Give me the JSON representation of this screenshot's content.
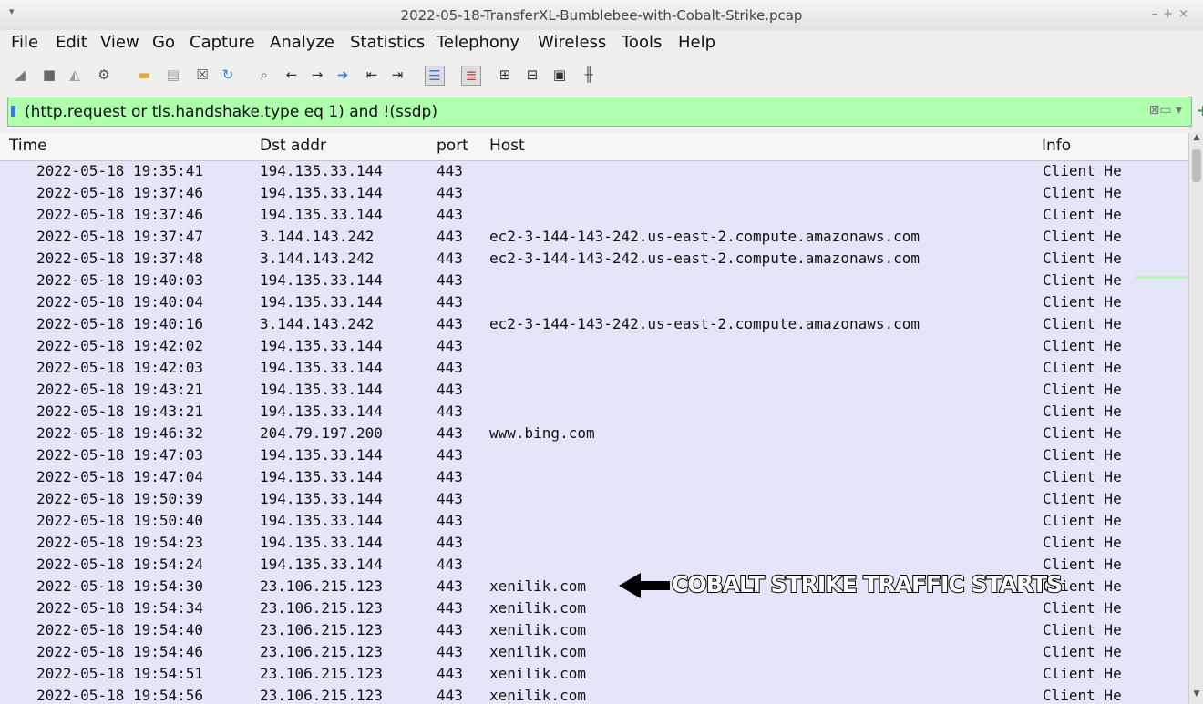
{
  "window": {
    "title": "2022-05-18-TransferXL-Bumblebee-with-Cobalt-Strike.pcap"
  },
  "menu": [
    "File",
    "Edit",
    "View",
    "Go",
    "Capture",
    "Analyze",
    "Statistics",
    "Telephony",
    "Wireless",
    "Tools",
    "Help"
  ],
  "toolbar_icons": [
    "shark-fin-start-icon",
    "stop-icon",
    "restart-icon",
    "options-gear-icon",
    "open-folder-icon",
    "file-icon",
    "close-file-icon",
    "reload-icon",
    "search-icon",
    "back-arrow-icon",
    "forward-arrow-icon",
    "go-to-packet-icon",
    "first-packet-icon",
    "last-packet-icon",
    "autoscroll-icon",
    "colorize-icon",
    "zoom-in-icon",
    "zoom-out-icon",
    "normal-size-icon",
    "resize-columns-icon"
  ],
  "filter": {
    "text": "(http.request or tls.handshake.type eq 1) and !(ssdp)"
  },
  "columns": {
    "time": "Time",
    "dst": "Dst addr",
    "port": "port",
    "host": "Host",
    "info": "Info"
  },
  "rows": [
    {
      "time": "2022-05-18 19:35:41",
      "dst": "194.135.33.144",
      "port": "443",
      "host": "",
      "info": "Client He"
    },
    {
      "time": "2022-05-18 19:37:46",
      "dst": "194.135.33.144",
      "port": "443",
      "host": "",
      "info": "Client He"
    },
    {
      "time": "2022-05-18 19:37:46",
      "dst": "194.135.33.144",
      "port": "443",
      "host": "",
      "info": "Client He"
    },
    {
      "time": "2022-05-18 19:37:47",
      "dst": "3.144.143.242",
      "port": "443",
      "host": "ec2-3-144-143-242.us-east-2.compute.amazonaws.com",
      "info": "Client He"
    },
    {
      "time": "2022-05-18 19:37:48",
      "dst": "3.144.143.242",
      "port": "443",
      "host": "ec2-3-144-143-242.us-east-2.compute.amazonaws.com",
      "info": "Client He"
    },
    {
      "time": "2022-05-18 19:40:03",
      "dst": "194.135.33.144",
      "port": "443",
      "host": "",
      "info": "Client He"
    },
    {
      "time": "2022-05-18 19:40:04",
      "dst": "194.135.33.144",
      "port": "443",
      "host": "",
      "info": "Client He"
    },
    {
      "time": "2022-05-18 19:40:16",
      "dst": "3.144.143.242",
      "port": "443",
      "host": "ec2-3-144-143-242.us-east-2.compute.amazonaws.com",
      "info": "Client He"
    },
    {
      "time": "2022-05-18 19:42:02",
      "dst": "194.135.33.144",
      "port": "443",
      "host": "",
      "info": "Client He"
    },
    {
      "time": "2022-05-18 19:42:03",
      "dst": "194.135.33.144",
      "port": "443",
      "host": "",
      "info": "Client He"
    },
    {
      "time": "2022-05-18 19:43:21",
      "dst": "194.135.33.144",
      "port": "443",
      "host": "",
      "info": "Client He"
    },
    {
      "time": "2022-05-18 19:43:21",
      "dst": "194.135.33.144",
      "port": "443",
      "host": "",
      "info": "Client He"
    },
    {
      "time": "2022-05-18 19:46:32",
      "dst": "204.79.197.200",
      "port": "443",
      "host": "www.bing.com",
      "info": "Client He"
    },
    {
      "time": "2022-05-18 19:47:03",
      "dst": "194.135.33.144",
      "port": "443",
      "host": "",
      "info": "Client He"
    },
    {
      "time": "2022-05-18 19:47:04",
      "dst": "194.135.33.144",
      "port": "443",
      "host": "",
      "info": "Client He"
    },
    {
      "time": "2022-05-18 19:50:39",
      "dst": "194.135.33.144",
      "port": "443",
      "host": "",
      "info": "Client He"
    },
    {
      "time": "2022-05-18 19:50:40",
      "dst": "194.135.33.144",
      "port": "443",
      "host": "",
      "info": "Client He"
    },
    {
      "time": "2022-05-18 19:54:23",
      "dst": "194.135.33.144",
      "port": "443",
      "host": "",
      "info": "Client He"
    },
    {
      "time": "2022-05-18 19:54:24",
      "dst": "194.135.33.144",
      "port": "443",
      "host": "",
      "info": "Client He"
    },
    {
      "time": "2022-05-18 19:54:30",
      "dst": "23.106.215.123",
      "port": "443",
      "host": "xenilik.com",
      "info": "Client He"
    },
    {
      "time": "2022-05-18 19:54:34",
      "dst": "23.106.215.123",
      "port": "443",
      "host": "xenilik.com",
      "info": "Client He"
    },
    {
      "time": "2022-05-18 19:54:40",
      "dst": "23.106.215.123",
      "port": "443",
      "host": "xenilik.com",
      "info": "Client He"
    },
    {
      "time": "2022-05-18 19:54:46",
      "dst": "23.106.215.123",
      "port": "443",
      "host": "xenilik.com",
      "info": "Client He"
    },
    {
      "time": "2022-05-18 19:54:51",
      "dst": "23.106.215.123",
      "port": "443",
      "host": "xenilik.com",
      "info": "Client He"
    },
    {
      "time": "2022-05-18 19:54:56",
      "dst": "23.106.215.123",
      "port": "443",
      "host": "xenilik.com",
      "info": "Client He"
    }
  ],
  "annotation": {
    "text": "COBALT STRIKE TRAFFIC STARTS"
  },
  "colors": {
    "filter_bg": "#afffaf",
    "row_bg": "#e5e5fa",
    "bookmark": "#3a7bd5"
  }
}
